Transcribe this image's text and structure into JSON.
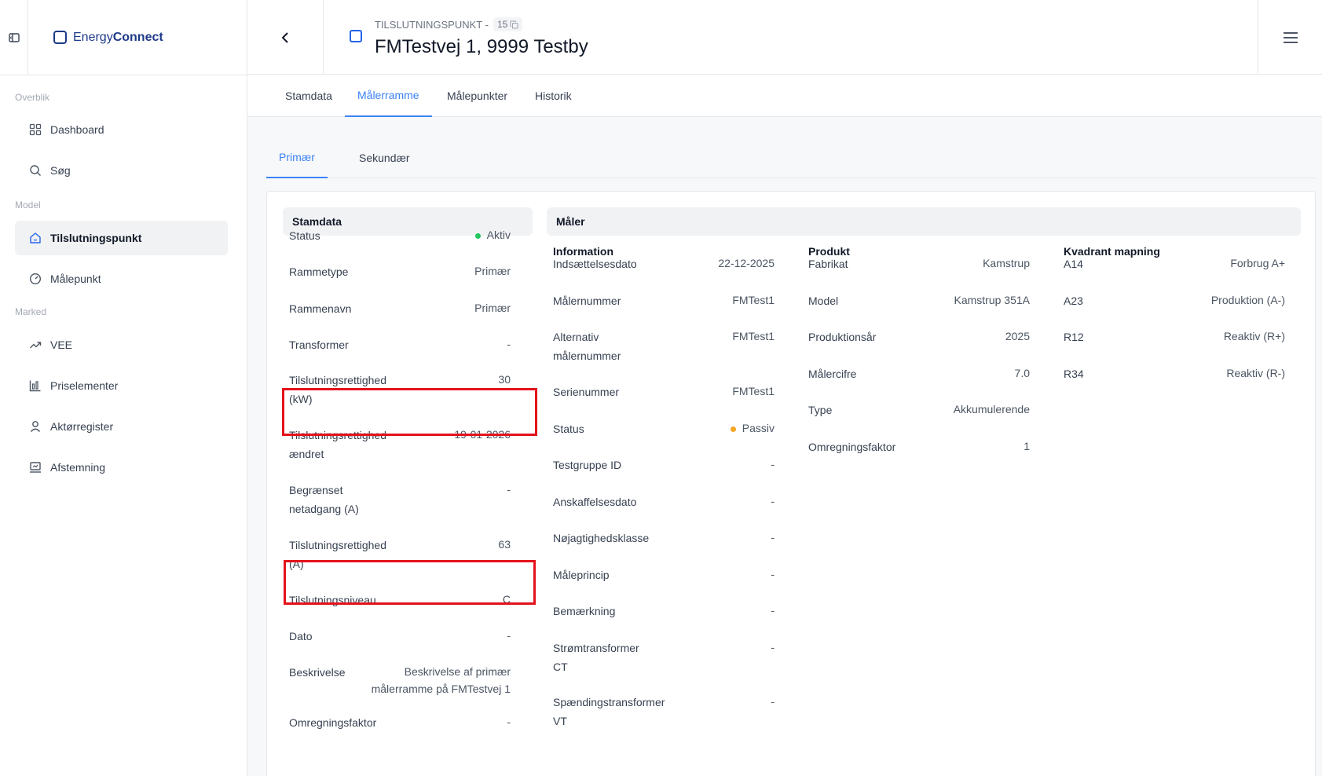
{
  "app": {
    "logo_light": "Energy",
    "logo_bold": "Connect"
  },
  "sidebar": {
    "sections": [
      "Overblik",
      "Model",
      "Marked"
    ],
    "items": [
      {
        "label": "Dashboard",
        "icon": "grid-icon"
      },
      {
        "label": "Søg",
        "icon": "search-icon"
      },
      {
        "label": "Tilslutningspunkt",
        "icon": "house-icon"
      },
      {
        "label": "Målepunkt",
        "icon": "gauge-icon"
      },
      {
        "label": "VEE",
        "icon": "trend-icon"
      },
      {
        "label": "Priselementer",
        "icon": "chart-icon"
      },
      {
        "label": "Aktørregister",
        "icon": "user-icon"
      },
      {
        "label": "Afstemning",
        "icon": "reconcile-icon"
      }
    ]
  },
  "header": {
    "subtitle": "TILSLUTNINGSPUNKT -",
    "id": "15",
    "title": "FMTestvej 1, 9999 Testby"
  },
  "tabs": [
    "Stamdata",
    "Målerramme",
    "Målepunkter",
    "Historik"
  ],
  "subtabs": [
    "Primær",
    "Sekundær"
  ],
  "stamdata": {
    "title": "Stamdata",
    "rows": [
      {
        "label": "Status",
        "value": "Aktiv"
      },
      {
        "label": "Rammetype",
        "value": "Primær"
      },
      {
        "label": "Rammenavn",
        "value": "Primær"
      },
      {
        "label": "Transformer",
        "value": "-"
      },
      {
        "label": "Tilslutningsrettighed\n(kW)",
        "value": "30"
      },
      {
        "label": "Tilslutningsrettighed\nændret",
        "value": "19-01-2026"
      },
      {
        "label": "Begrænset\nnetadgang (A)",
        "value": "-"
      },
      {
        "label": "Tilslutningsrettighed\n(A)",
        "value": "63"
      },
      {
        "label": "Tilslutningsniveau",
        "value": "C"
      },
      {
        "label": "Dato",
        "value": "-"
      },
      {
        "label": "Beskrivelse",
        "value": "Beskrivelse af primær\nmålerramme på FMTestvej 1"
      },
      {
        "label": "Omregningsfaktor",
        "value": "-"
      }
    ]
  },
  "maaler": {
    "title": "Måler",
    "information": {
      "title": "Information",
      "rows": [
        {
          "label": "Indsættelsesdato",
          "value": "22-12-2025"
        },
        {
          "label": "Målernummer",
          "value": "FMTest1"
        },
        {
          "label": "Alternativ\nmålernummer",
          "value": "FMTest1"
        },
        {
          "label": "Serienummer",
          "value": "FMTest1"
        },
        {
          "label": "Status",
          "value": "Passiv"
        },
        {
          "label": "Testgruppe ID",
          "value": "-"
        },
        {
          "label": "Anskaffelsesdato",
          "value": "-"
        },
        {
          "label": "Nøjagtighedsklasse",
          "value": "-"
        },
        {
          "label": "Måleprincip",
          "value": "-"
        },
        {
          "label": "Bemærkning",
          "value": "-"
        },
        {
          "label": "Strømtransformer\nCT",
          "value": "-"
        },
        {
          "label": "Spændingstransformer\nVT",
          "value": "-"
        }
      ]
    },
    "produkt": {
      "title": "Produkt",
      "rows": [
        {
          "label": "Fabrikat",
          "value": "Kamstrup"
        },
        {
          "label": "Model",
          "value": "Kamstrup 351A"
        },
        {
          "label": "Produktionsår",
          "value": "2025"
        },
        {
          "label": "Målercifre",
          "value": "7.0"
        },
        {
          "label": "Type",
          "value": "Akkumulerende"
        },
        {
          "label": "Omregningsfaktor",
          "value": "1"
        }
      ]
    },
    "kvadrant": {
      "title": "Kvadrant mapning",
      "rows": [
        {
          "label": "A14",
          "value": "Forbrug A+"
        },
        {
          "label": "A23",
          "value": "Produktion (A-)"
        },
        {
          "label": "R12",
          "value": "Reaktiv (R+)"
        },
        {
          "label": "R34",
          "value": "Reaktiv (R-)"
        }
      ]
    }
  },
  "colors": {
    "accent": "#3b82f6",
    "brand": "#1e3a8a",
    "active_status": "#22c55e",
    "passive_status": "#f5a623",
    "highlight": "#e3121b"
  }
}
